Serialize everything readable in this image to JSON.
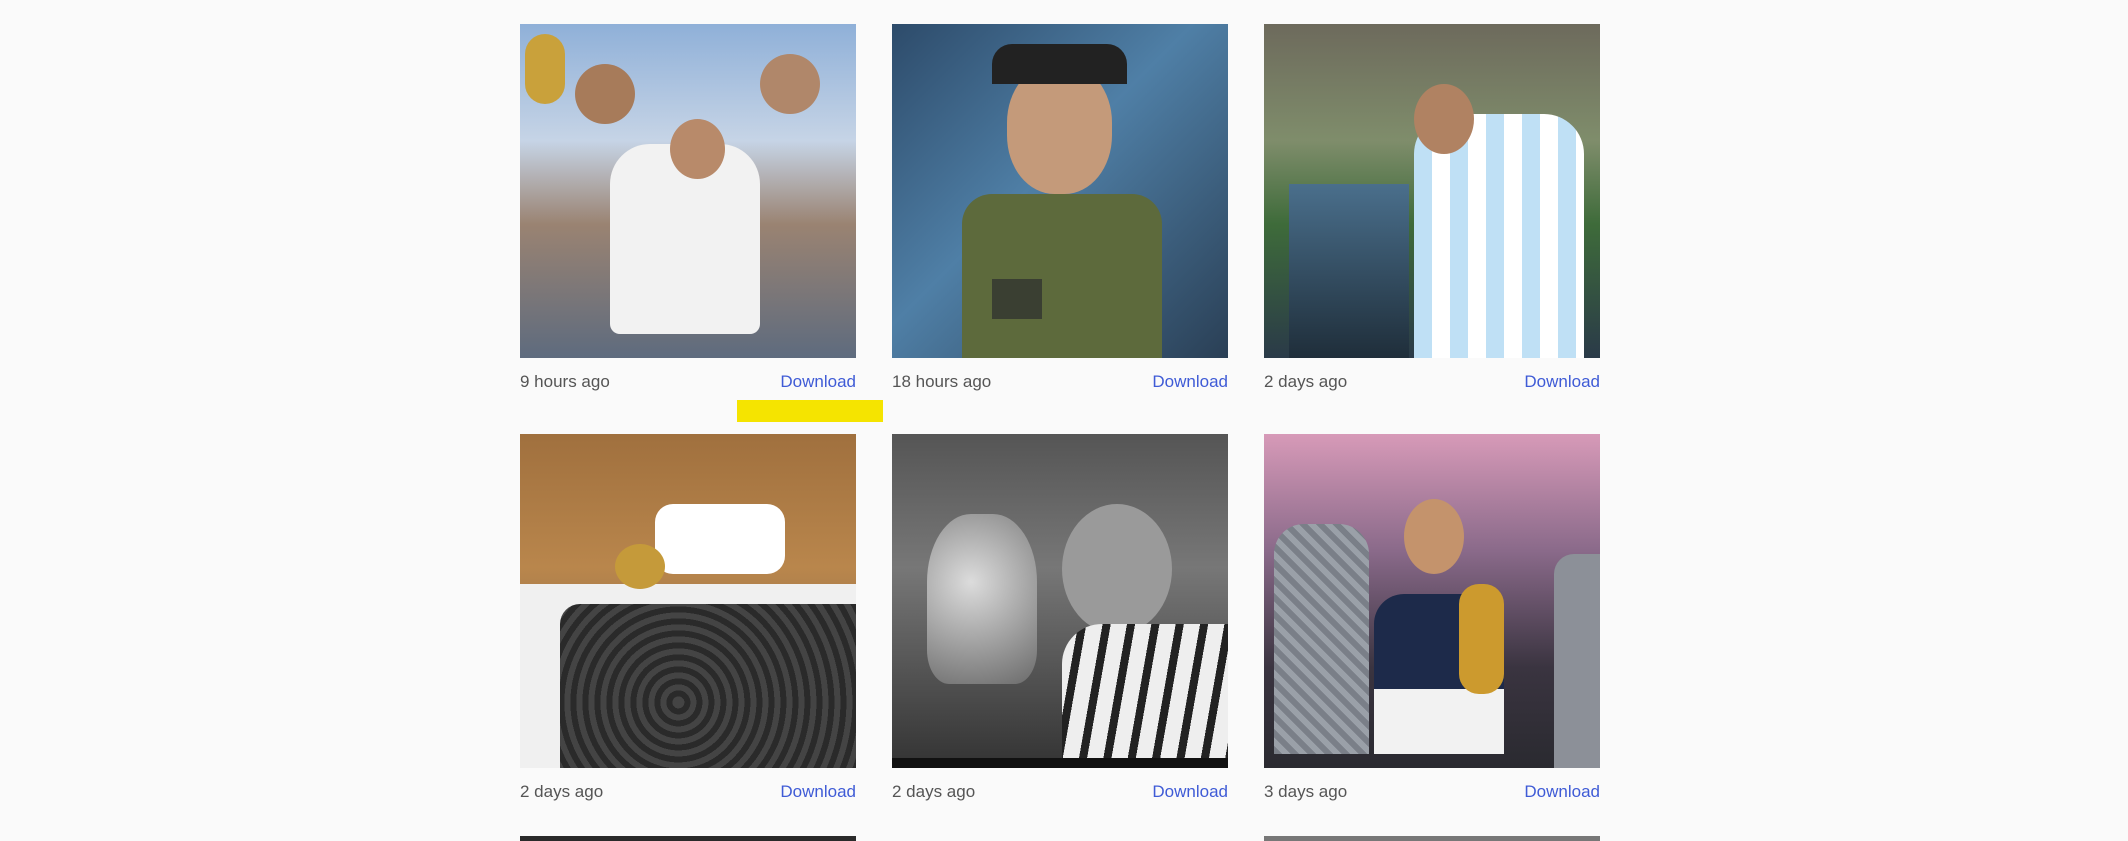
{
  "posts": [
    {
      "time": "9 hours ago",
      "download": "Download",
      "has_media_icon": false,
      "icon": ""
    },
    {
      "time": "18 hours ago",
      "download": "Download",
      "has_media_icon": true,
      "icon": "video-camera-icon"
    },
    {
      "time": "2 days ago",
      "download": "Download",
      "has_media_icon": true,
      "icon": "video-camera-icon"
    },
    {
      "time": "2 days ago",
      "download": "Download",
      "has_media_icon": false,
      "icon": ""
    },
    {
      "time": "2 days ago",
      "download": "Download",
      "has_media_icon": true,
      "icon": "video-camera-icon"
    },
    {
      "time": "3 days ago",
      "download": "Download",
      "has_media_icon": false,
      "icon": ""
    }
  ],
  "colors": {
    "link": "#3f5bd6",
    "highlight": "#f5e400",
    "background": "#fafafa"
  }
}
